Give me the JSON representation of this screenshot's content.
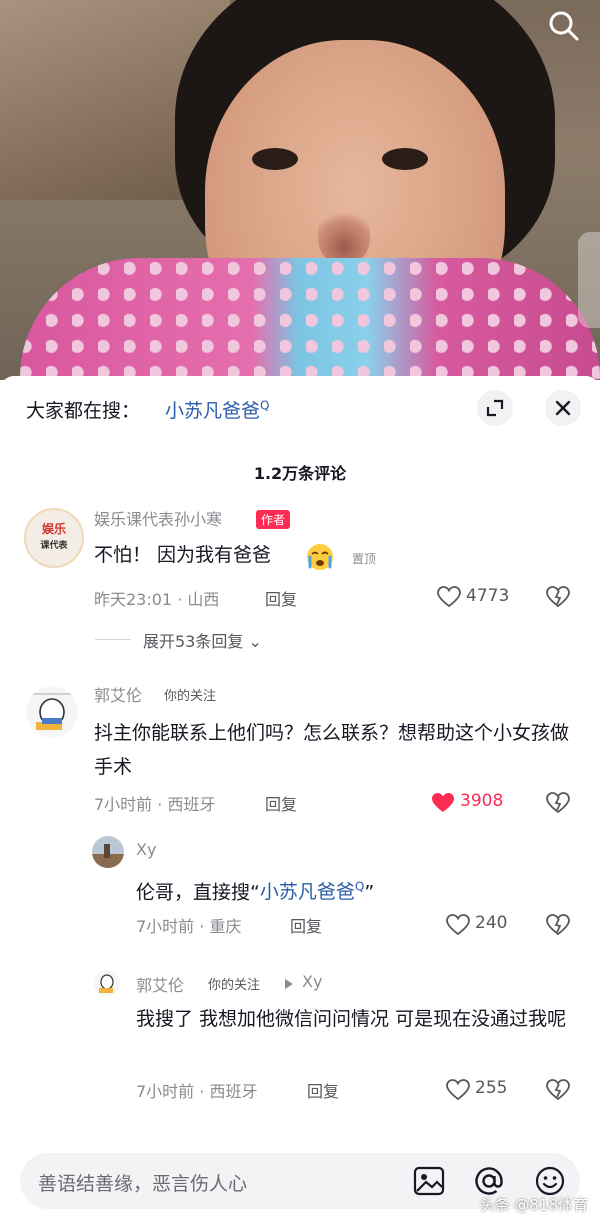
{
  "topbar": {
    "search_prefix": "大家都在搜：",
    "search_term": "小苏凡爸爸",
    "search_glyph": "Q"
  },
  "comments_count": "1.2万条评论",
  "comments": [
    {
      "avatar_text_top": "娱乐",
      "avatar_text_bottom": "课代表",
      "user": "娱乐课代表孙小寒",
      "badge": "作者",
      "text": "不怕！ 因为我有爸爸",
      "pinned": "置顶",
      "time": "昨天23:01 · 山西",
      "reply": "回复",
      "likes": "4773",
      "expand": "展开53条回复"
    },
    {
      "user": "郭艾伦",
      "tag": "你的关注",
      "text": "抖主你能联系上他们吗？怎么联系？想帮助这个小女孩做手术",
      "time": "7小时前 · 西班牙",
      "reply": "回复",
      "likes": "3908",
      "liked_color": "#fe2c55"
    }
  ],
  "replies": [
    {
      "user": "Xy",
      "text_prefix": "伦哥，直接搜“",
      "text_term": "小苏凡爸爸",
      "text_suffix": "”",
      "time": "7小时前 · 重庆",
      "reply": "回复",
      "likes": "240"
    },
    {
      "user": "郭艾伦",
      "tag": "你的关注",
      "reply_to": "Xy",
      "text": "我搜了 我想加他微信问问情况 可是现在没通过我呢",
      "time": "7小时前 · 西班牙",
      "reply": "回复",
      "likes": "255"
    }
  ],
  "input": {
    "placeholder": "善语结善缘，恶言伤人心"
  },
  "watermark": "头条 @818体育"
}
